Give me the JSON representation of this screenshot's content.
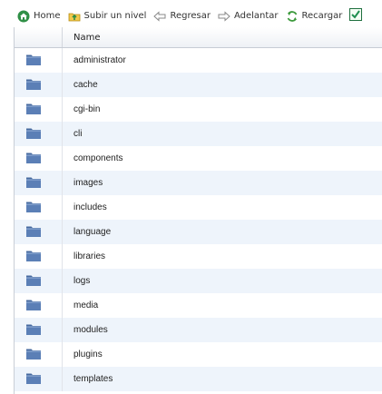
{
  "toolbar": {
    "home_label": "Home",
    "up_label": "Subir un nivel",
    "back_label": "Regresar",
    "forward_label": "Adelantar",
    "reload_label": "Recargar",
    "checkbox_checked": true
  },
  "table": {
    "header_name": "Name",
    "rows": [
      {
        "name": "administrator",
        "icon": "folder-icon"
      },
      {
        "name": "cache",
        "icon": "folder-icon"
      },
      {
        "name": "cgi-bin",
        "icon": "folder-icon"
      },
      {
        "name": "cli",
        "icon": "folder-icon"
      },
      {
        "name": "components",
        "icon": "folder-icon"
      },
      {
        "name": "images",
        "icon": "folder-icon"
      },
      {
        "name": "includes",
        "icon": "folder-icon"
      },
      {
        "name": "language",
        "icon": "folder-icon"
      },
      {
        "name": "libraries",
        "icon": "folder-icon"
      },
      {
        "name": "logs",
        "icon": "folder-icon"
      },
      {
        "name": "media",
        "icon": "folder-icon"
      },
      {
        "name": "modules",
        "icon": "folder-icon"
      },
      {
        "name": "plugins",
        "icon": "folder-icon"
      },
      {
        "name": "templates",
        "icon": "folder-icon"
      }
    ]
  },
  "colors": {
    "folder": "#5b7fb6",
    "folder_dark": "#476a9f",
    "row_alt": "#eef4fb",
    "checkbox_green": "#2e8b57"
  }
}
